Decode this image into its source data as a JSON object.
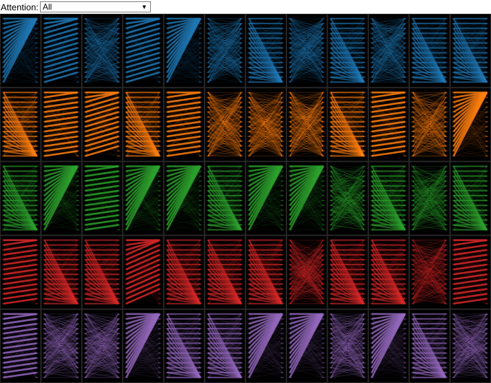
{
  "attention_control": {
    "label": "Attention:",
    "selected": "All"
  },
  "attention_grid": {
    "layers": 5,
    "heads_per_layer": 12,
    "tokens": 14,
    "layer_colors": [
      "#1f77b4",
      "#ff7f0e",
      "#2ca02c",
      "#d62728",
      "#9467bd"
    ],
    "background": "#000000"
  }
}
